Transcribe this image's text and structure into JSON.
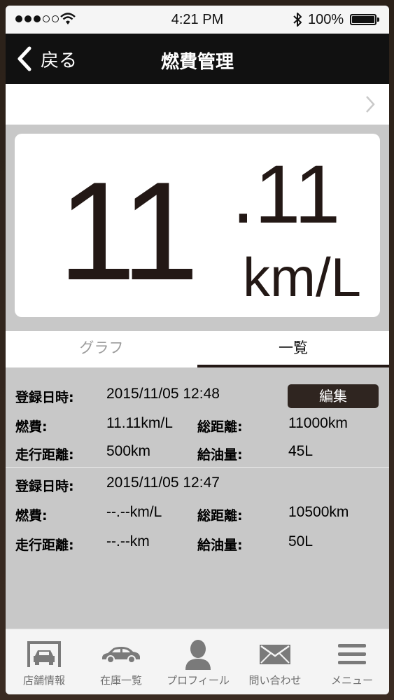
{
  "status_bar": {
    "time": "4:21 PM",
    "battery_percent": "100%",
    "signal_filled": 3,
    "signal_total": 5
  },
  "nav": {
    "back_label": "戻る",
    "title": "燃費管理"
  },
  "fuel": {
    "integer": "11",
    "decimal": ".11",
    "unit": "km/L"
  },
  "tabs": {
    "graph": "グラフ",
    "list": "一覧",
    "active": "list"
  },
  "labels": {
    "date": "登録日時:",
    "fuel_economy": "燃費:",
    "total_distance": "総距離:",
    "distance": "走行距離:",
    "refuel": "給油量:",
    "edit": "編集"
  },
  "records": [
    {
      "date": "2015/11/05 12:48",
      "fuel_economy": "11.11km/L",
      "total_distance": "11000km",
      "distance": "500km",
      "refuel": "45L"
    },
    {
      "date": "2015/11/05 12:47",
      "fuel_economy": "--.--km/L",
      "total_distance": "10500km",
      "distance": "--.--km",
      "refuel": "50L"
    }
  ],
  "tabbar": [
    {
      "label": "店舗情報",
      "icon": "garage-icon"
    },
    {
      "label": "在庫一覧",
      "icon": "car-icon"
    },
    {
      "label": "プロフィール",
      "icon": "person-icon"
    },
    {
      "label": "問い合わせ",
      "icon": "mail-icon"
    },
    {
      "label": "メニュー",
      "icon": "menu-icon"
    }
  ],
  "colors": {
    "navbar": "#111111",
    "accent_dark": "#2f2520",
    "content_bg": "#c8c8c8",
    "tab_icon": "#7a7a7a"
  }
}
